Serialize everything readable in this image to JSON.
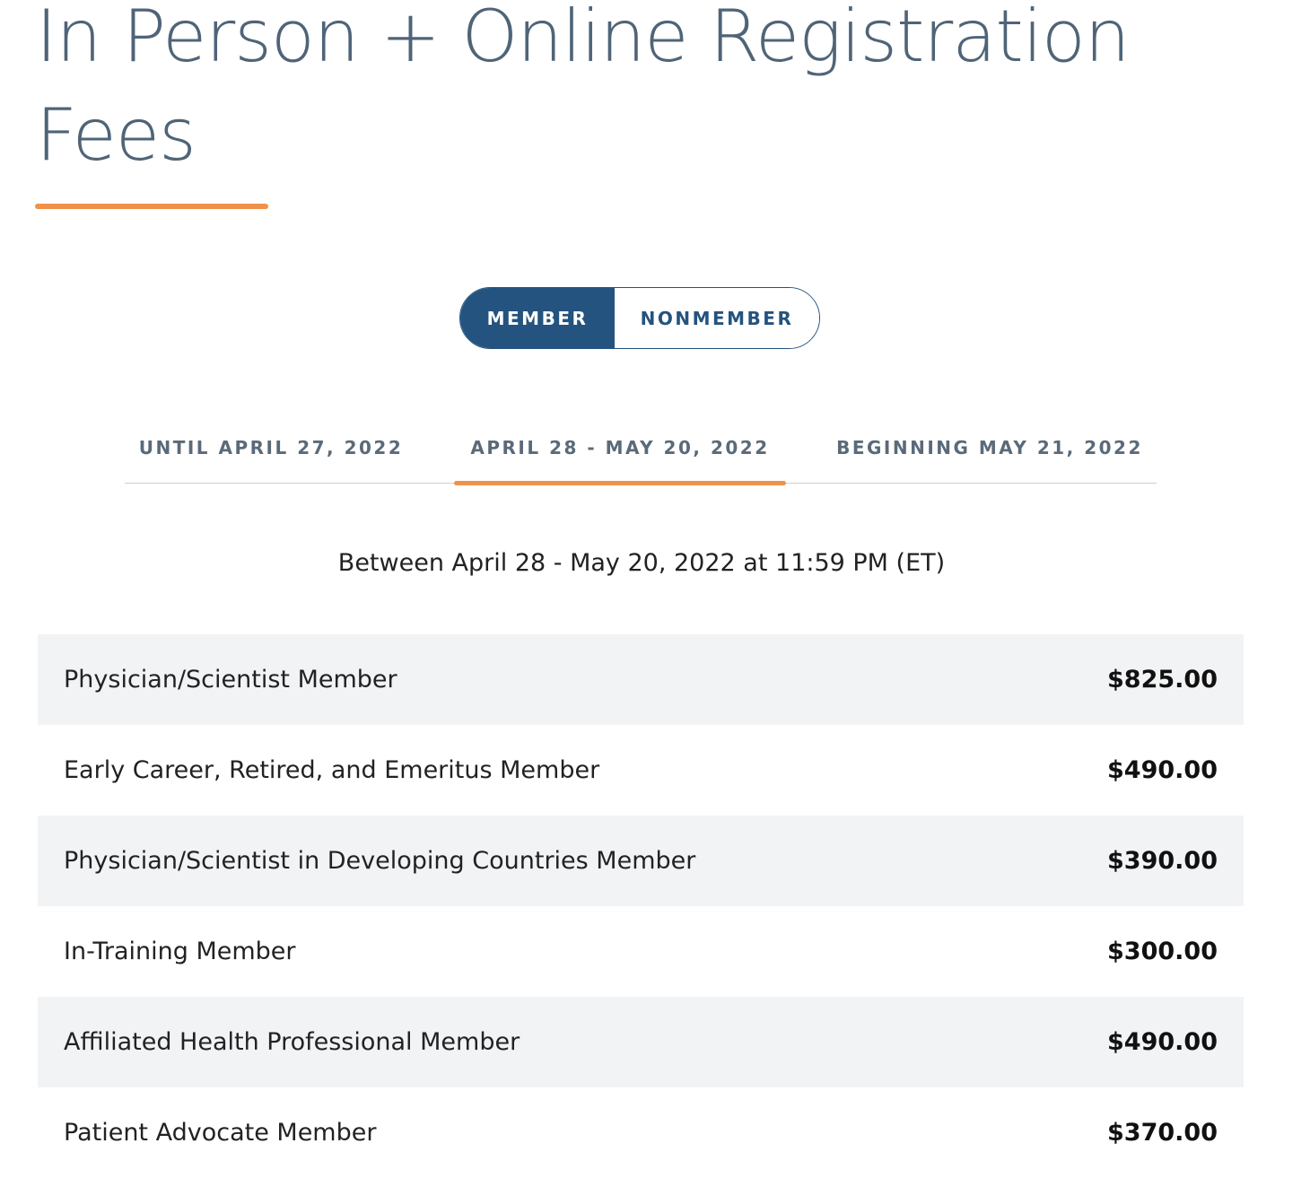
{
  "header": {
    "title": "In Person + Online Registration Fees"
  },
  "colors": {
    "accent": "#f0924a",
    "primary": "#24537f",
    "title_text": "#4f6478",
    "row_alt_bg": "#f2f3f5"
  },
  "membership_toggle": {
    "options": [
      {
        "label": "MEMBER",
        "selected": true
      },
      {
        "label": "NONMEMBER",
        "selected": false
      }
    ]
  },
  "date_tabs": {
    "active_index": 1,
    "tabs": [
      {
        "label": "UNTIL APRIL 27, 2022"
      },
      {
        "label": "APRIL 28 - MAY 20, 2022"
      },
      {
        "label": "BEGINNING MAY 21, 2022"
      }
    ]
  },
  "period": {
    "description": "Between April 28 - May 20, 2022 at 11:59 PM (ET)"
  },
  "fees": [
    {
      "category": "Physician/Scientist Member",
      "price": "$825.00"
    },
    {
      "category": "Early Career, Retired, and Emeritus Member",
      "price": "$490.00"
    },
    {
      "category": "Physician/Scientist in Developing Countries Member",
      "price": "$390.00"
    },
    {
      "category": "In-Training Member",
      "price": "$300.00"
    },
    {
      "category": "Affiliated Health Professional Member",
      "price": "$490.00"
    },
    {
      "category": "Patient Advocate Member",
      "price": "$370.00"
    }
  ]
}
